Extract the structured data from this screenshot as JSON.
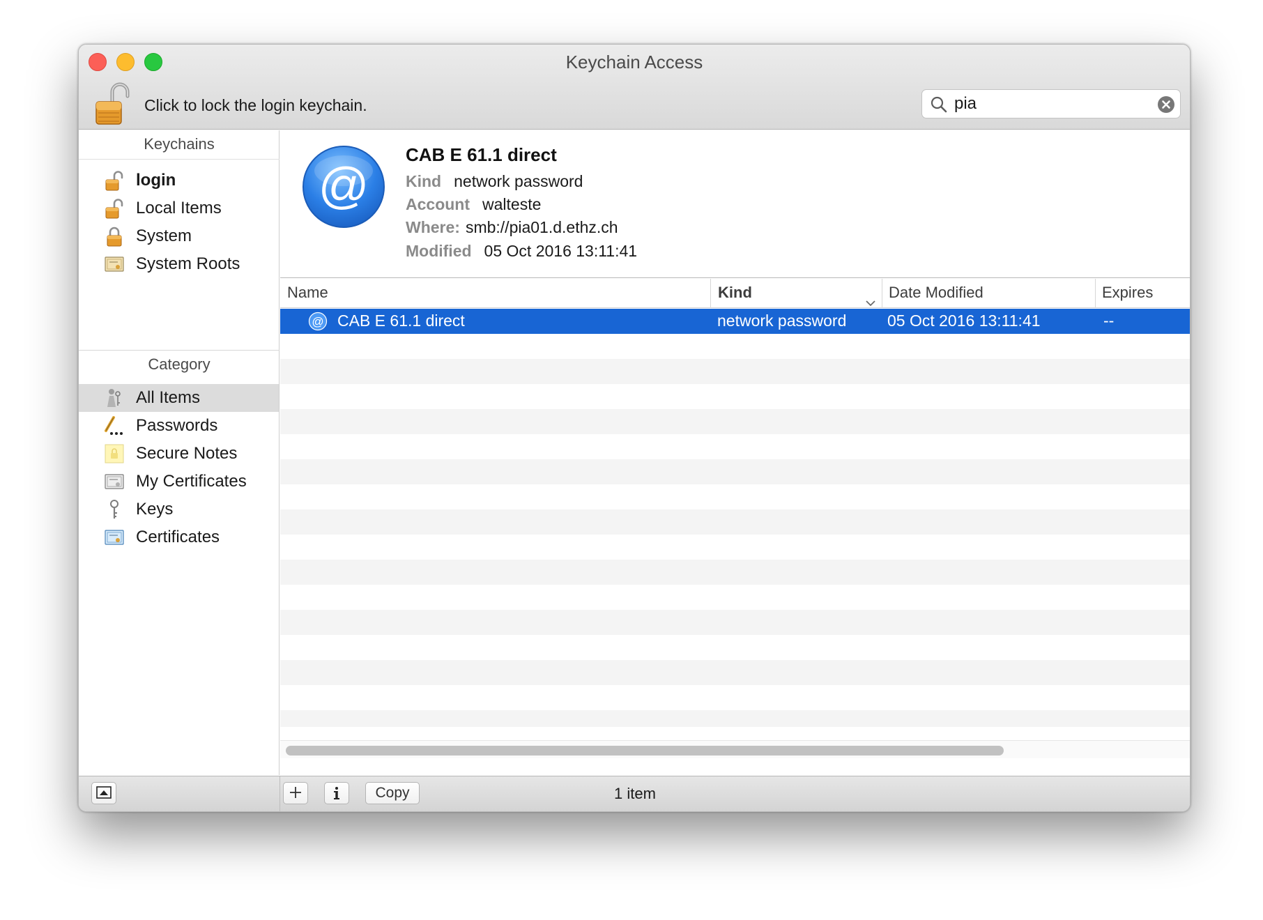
{
  "window": {
    "title": "Keychain Access"
  },
  "toolbar": {
    "lock_label": "Click to lock the login keychain.",
    "search": {
      "value": "pia",
      "placeholder": "Search"
    }
  },
  "sidebar": {
    "keychains_header": "Keychains",
    "keychains": [
      {
        "label": "login",
        "icon": "unlocked-padlock-icon",
        "bold": true
      },
      {
        "label": "Local Items",
        "icon": "unlocked-padlock-icon"
      },
      {
        "label": "System",
        "icon": "locked-padlock-icon"
      },
      {
        "label": "System Roots",
        "icon": "certificate-icon"
      }
    ],
    "category_header": "Category",
    "categories": [
      {
        "label": "All Items",
        "icon": "keys-people-icon",
        "selected": true
      },
      {
        "label": "Passwords",
        "icon": "pencil-password-icon"
      },
      {
        "label": "Secure Notes",
        "icon": "secure-note-icon"
      },
      {
        "label": "My Certificates",
        "icon": "my-certificate-icon"
      },
      {
        "label": "Keys",
        "icon": "key-icon"
      },
      {
        "label": "Certificates",
        "icon": "certificate-icon"
      }
    ]
  },
  "detail": {
    "icon": "at-sign-icon",
    "title": "CAB E 61.1 direct",
    "kind_key": "Kind",
    "kind_val": "network password",
    "account_key": "Account",
    "account_val": "walteste",
    "where_key": "Where:",
    "where_val": "smb://pia01.d.ethz.ch",
    "modified_key": "Modified",
    "modified_val": "05 Oct 2016 13:11:41"
  },
  "table": {
    "columns": {
      "name": "Name",
      "kind": "Kind",
      "date": "Date Modified",
      "expires": "Expires"
    },
    "sorted_column": "Kind",
    "rows": [
      {
        "name": "CAB E 61.1 direct",
        "kind": "network password",
        "date": "05 Oct 2016 13:11:41",
        "expires": "--",
        "selected": true
      }
    ]
  },
  "bottom_bar": {
    "copy_label": "Copy",
    "status": "1 item"
  },
  "colors": {
    "selection": "#1865d4",
    "traffic_close": "#fc5f57",
    "traffic_minimize": "#fdbc2e",
    "traffic_zoom": "#28c840"
  }
}
